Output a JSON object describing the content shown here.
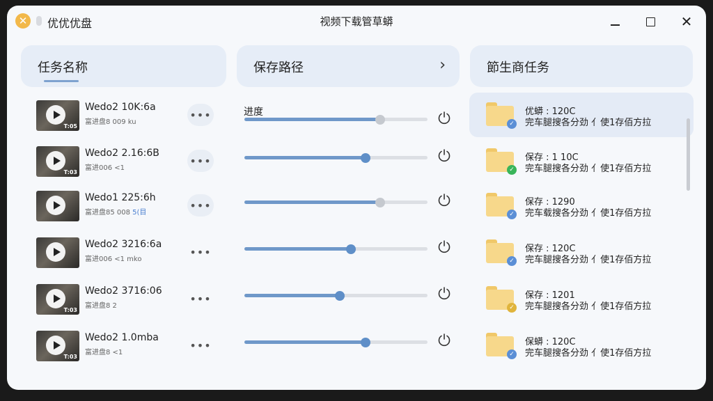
{
  "app": {
    "logo": "✕",
    "name": "优优优盘",
    "window_title": "视频下载管草蟒"
  },
  "headers": {
    "task_name": "任务名称",
    "save_path": "保存路径",
    "new_tasks": "節生商任务"
  },
  "progress_label": "进度",
  "colors": {
    "accent": "#5f8fc8",
    "track": "#dcdfe4",
    "header_bg": "#e6edf7",
    "folder": "#f7d88b"
  },
  "downloads": [
    {
      "name": "Wedo2 10K:6a",
      "sub": "富进盘8 009 ku",
      "sub_link": "",
      "tag": "T:05",
      "progress": 0.74,
      "knob": "grey"
    },
    {
      "name": "Wedo2 2.16:6B",
      "sub": "富进006 <1",
      "sub_link": "",
      "tag": "T:03",
      "progress": 0.66,
      "knob": "blue"
    },
    {
      "name": "Wedo1 225:6h",
      "sub": "富进盘85 008 ",
      "sub_link": "5(目",
      "tag": "",
      "progress": 0.74,
      "knob": "grey"
    },
    {
      "name": "Wedo2 3216:6a",
      "sub": "富进006 <1 mko",
      "sub_link": "",
      "tag": "",
      "progress": 0.58,
      "knob": "blue"
    },
    {
      "name": "Wedo2 3716:06",
      "sub": "富进盘8 2",
      "sub_link": "",
      "tag": "T:03",
      "progress": 0.52,
      "knob": "blue"
    },
    {
      "name": "Wedo2 1.0mba",
      "sub": "富进盘8 <1",
      "sub_link": "",
      "tag": "T:03",
      "progress": 0.66,
      "knob": "blue"
    }
  ],
  "tasks": [
    {
      "title": "优蟒 : 120C",
      "desc": "完车腿搜各分劲 亻使1存佰方拉",
      "badge": "check-blue",
      "badge_glyph": "✓",
      "badge_color": "#5b8fd6"
    },
    {
      "title": "保存 : 1 10C",
      "desc": "完车腿搜各分劲 亻使1存佰方拉",
      "badge": "check-green",
      "badge_glyph": "✓",
      "badge_color": "#39b55a"
    },
    {
      "title": "保存 : 1290",
      "desc": "完车载搜各分劲 亻使1存佰方拉",
      "badge": "check-blue",
      "badge_glyph": "✓",
      "badge_color": "#5b8fd6"
    },
    {
      "title": "保存 : 120C",
      "desc": "完车腿搜各分劲 亻使1存佰方拉",
      "badge": "check-blue",
      "badge_glyph": "✓",
      "badge_color": "#5b8fd6"
    },
    {
      "title": "保存 : 1201",
      "desc": "完车腿搜各分劲 亻使1存佰方拉",
      "badge": "check-yellow",
      "badge_glyph": "✓",
      "badge_color": "#e0b43c"
    },
    {
      "title": "保蟒 : 120C",
      "desc": "完车腿搜各分劲 亻使1存佰方拉",
      "badge": "check-blue",
      "badge_glyph": "✓",
      "badge_color": "#5b8fd6"
    }
  ]
}
